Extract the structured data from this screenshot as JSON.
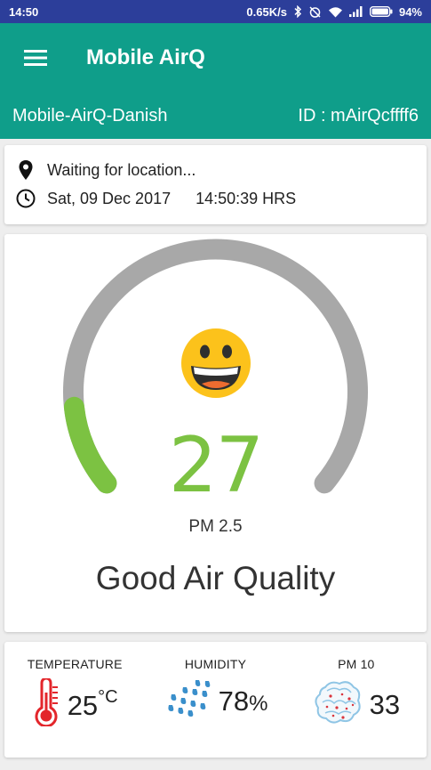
{
  "status_bar": {
    "time": "14:50",
    "net_speed": "0.65K/s",
    "battery": "94%"
  },
  "app_bar": {
    "title": "Mobile AirQ",
    "menu_icon": "hamburger-menu-icon"
  },
  "device": {
    "name": "Mobile-AirQ-Danish",
    "id_label": "ID : mAirQcffff6"
  },
  "info": {
    "location_text": "Waiting for location...",
    "date": "Sat, 09 Dec 2017",
    "time": "14:50:39 HRS"
  },
  "gauge": {
    "value": "27",
    "value_fraction": 0.13,
    "label": "PM 2.5",
    "quality": "Good Air Quality",
    "track_color": "#a8a8a8",
    "fill_color": "#7cc242",
    "face_icon": "grinning-face-icon"
  },
  "metrics": {
    "temperature": {
      "title": "TEMPERATURE",
      "value": "25",
      "unit": "°C",
      "icon": "thermometer-icon"
    },
    "humidity": {
      "title": "HUMIDITY",
      "value": "78",
      "unit": "%",
      "icon": "raindrops-icon"
    },
    "pm10": {
      "title": "PM 10",
      "value": "33",
      "icon": "particles-icon"
    }
  },
  "colors": {
    "status_bar": "#2c3e9a",
    "app_bar": "#0f9e8a",
    "accent_green": "#7cc242"
  }
}
